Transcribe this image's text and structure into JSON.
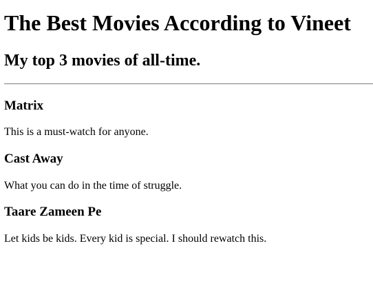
{
  "page": {
    "title": "The Best Movies According to Vineet",
    "subtitle": "My top 3 movies of all-time."
  },
  "movies": [
    {
      "title": "Matrix",
      "description": "This is a must-watch for anyone."
    },
    {
      "title": "Cast Away",
      "description": "What you can do in the time of struggle."
    },
    {
      "title": "Taare Zameen Pe",
      "description": "Let kids be kids. Every kid is special. I should rewatch this."
    }
  ]
}
